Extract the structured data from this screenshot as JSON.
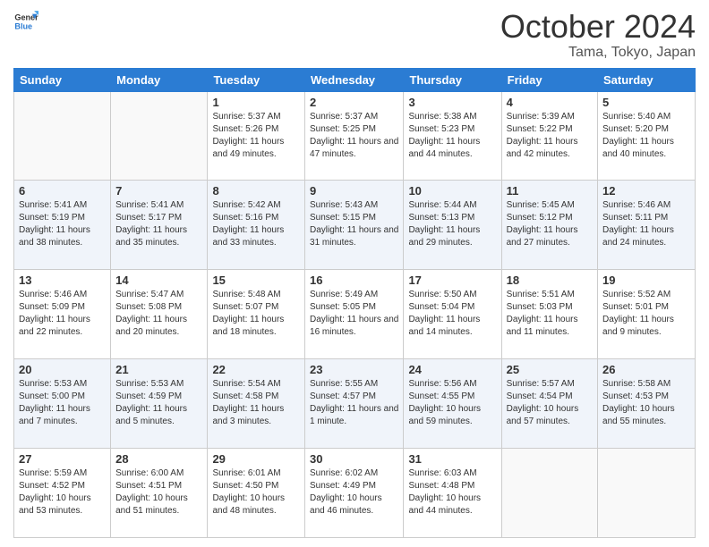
{
  "header": {
    "logo_line1": "General",
    "logo_line2": "Blue",
    "month": "October 2024",
    "location": "Tama, Tokyo, Japan"
  },
  "days_of_week": [
    "Sunday",
    "Monday",
    "Tuesday",
    "Wednesday",
    "Thursday",
    "Friday",
    "Saturday"
  ],
  "weeks": [
    [
      {
        "day": "",
        "empty": true
      },
      {
        "day": "",
        "empty": true
      },
      {
        "day": "1",
        "sunrise": "5:37 AM",
        "sunset": "5:26 PM",
        "daylight": "11 hours and 49 minutes."
      },
      {
        "day": "2",
        "sunrise": "5:37 AM",
        "sunset": "5:25 PM",
        "daylight": "11 hours and 47 minutes."
      },
      {
        "day": "3",
        "sunrise": "5:38 AM",
        "sunset": "5:23 PM",
        "daylight": "11 hours and 44 minutes."
      },
      {
        "day": "4",
        "sunrise": "5:39 AM",
        "sunset": "5:22 PM",
        "daylight": "11 hours and 42 minutes."
      },
      {
        "day": "5",
        "sunrise": "5:40 AM",
        "sunset": "5:20 PM",
        "daylight": "11 hours and 40 minutes."
      }
    ],
    [
      {
        "day": "6",
        "sunrise": "5:41 AM",
        "sunset": "5:19 PM",
        "daylight": "11 hours and 38 minutes."
      },
      {
        "day": "7",
        "sunrise": "5:41 AM",
        "sunset": "5:17 PM",
        "daylight": "11 hours and 35 minutes."
      },
      {
        "day": "8",
        "sunrise": "5:42 AM",
        "sunset": "5:16 PM",
        "daylight": "11 hours and 33 minutes."
      },
      {
        "day": "9",
        "sunrise": "5:43 AM",
        "sunset": "5:15 PM",
        "daylight": "11 hours and 31 minutes."
      },
      {
        "day": "10",
        "sunrise": "5:44 AM",
        "sunset": "5:13 PM",
        "daylight": "11 hours and 29 minutes."
      },
      {
        "day": "11",
        "sunrise": "5:45 AM",
        "sunset": "5:12 PM",
        "daylight": "11 hours and 27 minutes."
      },
      {
        "day": "12",
        "sunrise": "5:46 AM",
        "sunset": "5:11 PM",
        "daylight": "11 hours and 24 minutes."
      }
    ],
    [
      {
        "day": "13",
        "sunrise": "5:46 AM",
        "sunset": "5:09 PM",
        "daylight": "11 hours and 22 minutes."
      },
      {
        "day": "14",
        "sunrise": "5:47 AM",
        "sunset": "5:08 PM",
        "daylight": "11 hours and 20 minutes."
      },
      {
        "day": "15",
        "sunrise": "5:48 AM",
        "sunset": "5:07 PM",
        "daylight": "11 hours and 18 minutes."
      },
      {
        "day": "16",
        "sunrise": "5:49 AM",
        "sunset": "5:05 PM",
        "daylight": "11 hours and 16 minutes."
      },
      {
        "day": "17",
        "sunrise": "5:50 AM",
        "sunset": "5:04 PM",
        "daylight": "11 hours and 14 minutes."
      },
      {
        "day": "18",
        "sunrise": "5:51 AM",
        "sunset": "5:03 PM",
        "daylight": "11 hours and 11 minutes."
      },
      {
        "day": "19",
        "sunrise": "5:52 AM",
        "sunset": "5:01 PM",
        "daylight": "11 hours and 9 minutes."
      }
    ],
    [
      {
        "day": "20",
        "sunrise": "5:53 AM",
        "sunset": "5:00 PM",
        "daylight": "11 hours and 7 minutes."
      },
      {
        "day": "21",
        "sunrise": "5:53 AM",
        "sunset": "4:59 PM",
        "daylight": "11 hours and 5 minutes."
      },
      {
        "day": "22",
        "sunrise": "5:54 AM",
        "sunset": "4:58 PM",
        "daylight": "11 hours and 3 minutes."
      },
      {
        "day": "23",
        "sunrise": "5:55 AM",
        "sunset": "4:57 PM",
        "daylight": "11 hours and 1 minute."
      },
      {
        "day": "24",
        "sunrise": "5:56 AM",
        "sunset": "4:55 PM",
        "daylight": "10 hours and 59 minutes."
      },
      {
        "day": "25",
        "sunrise": "5:57 AM",
        "sunset": "4:54 PM",
        "daylight": "10 hours and 57 minutes."
      },
      {
        "day": "26",
        "sunrise": "5:58 AM",
        "sunset": "4:53 PM",
        "daylight": "10 hours and 55 minutes."
      }
    ],
    [
      {
        "day": "27",
        "sunrise": "5:59 AM",
        "sunset": "4:52 PM",
        "daylight": "10 hours and 53 minutes."
      },
      {
        "day": "28",
        "sunrise": "6:00 AM",
        "sunset": "4:51 PM",
        "daylight": "10 hours and 51 minutes."
      },
      {
        "day": "29",
        "sunrise": "6:01 AM",
        "sunset": "4:50 PM",
        "daylight": "10 hours and 48 minutes."
      },
      {
        "day": "30",
        "sunrise": "6:02 AM",
        "sunset": "4:49 PM",
        "daylight": "10 hours and 46 minutes."
      },
      {
        "day": "31",
        "sunrise": "6:03 AM",
        "sunset": "4:48 PM",
        "daylight": "10 hours and 44 minutes."
      },
      {
        "day": "",
        "empty": true
      },
      {
        "day": "",
        "empty": true
      }
    ]
  ]
}
